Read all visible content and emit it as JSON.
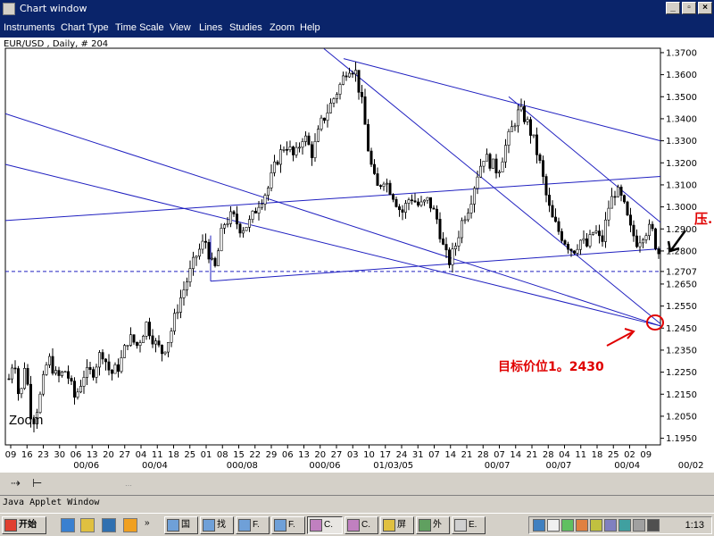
{
  "window": {
    "title": "Chart window",
    "minimize": "_",
    "restore": "▫",
    "close": "×"
  },
  "menu": [
    "Instruments",
    "Chart Type",
    "Time Scale",
    "View",
    "Lines",
    "Studies",
    "Zoom",
    "Help"
  ],
  "chart_header": "EUR/USD , Daily, # 204",
  "zoom_label": "Zoom",
  "chart_data": {
    "type": "candlestick",
    "instrument": "EUR/USD",
    "y_ticks": [
      "1.3700",
      "1.3600",
      "1.3500",
      "1.3400",
      "1.3300",
      "1.3200",
      "1.3100",
      "1.3000",
      "1.2900",
      "1.2800",
      "1.2707",
      "1.2650",
      "1.2550",
      "1.2450",
      "1.2350",
      "1.2250",
      "1.2150",
      "1.2050",
      "1.1950"
    ],
    "ylim": [
      1.192,
      1.372
    ],
    "x_ticks": [
      "09",
      "16",
      "23",
      "30",
      "06",
      "13",
      "20",
      "27",
      "04",
      "11",
      "18",
      "25",
      "01",
      "08",
      "15",
      "22",
      "29",
      "06",
      "13",
      "20",
      "27",
      "03",
      "10",
      "17",
      "24",
      "31",
      "07",
      "14",
      "21",
      "28",
      "07",
      "14",
      "21",
      "28",
      "04",
      "11",
      "18",
      "25",
      "02",
      "09"
    ],
    "x_months": [
      "00/06",
      "00/04",
      "000/08",
      "000/06",
      "01/03/05",
      "00/07",
      "00/07",
      "00/04",
      "00/02"
    ],
    "current_price": 1.2707,
    "annotations": [
      "目标价位1。2430",
      "压."
    ]
  },
  "applet_label": "Java Applet Window",
  "taskbar": {
    "start": "开始",
    "buttons": [
      "国",
      "找",
      "F.",
      "F.",
      "C.",
      "C.",
      "屏",
      "外",
      "E."
    ],
    "clock": "1:13"
  }
}
